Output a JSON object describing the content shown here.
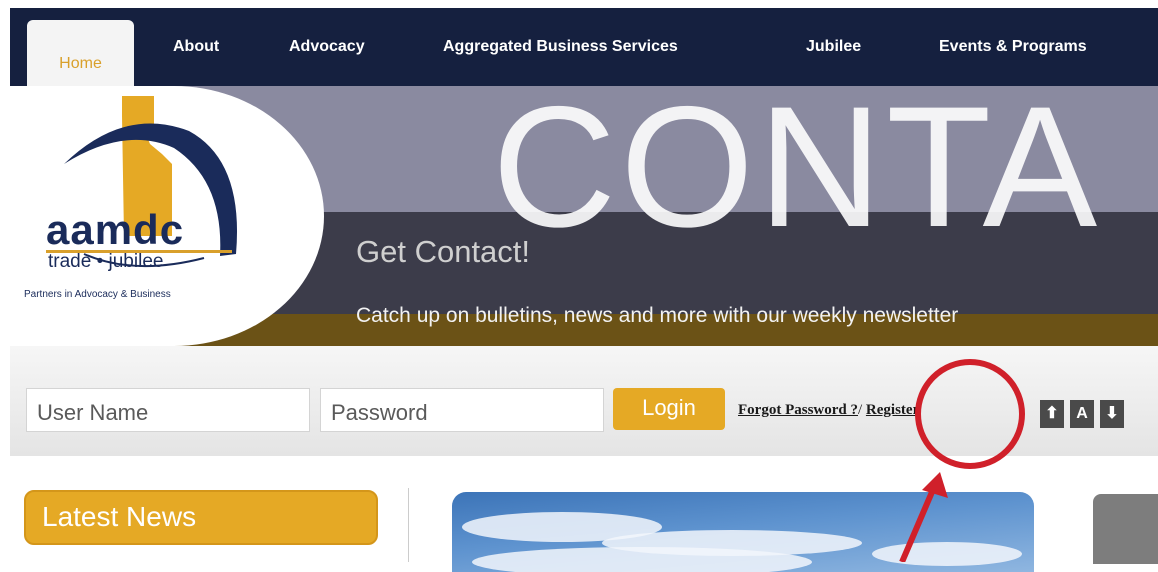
{
  "nav": {
    "items": [
      "Home",
      "About",
      "Advocacy",
      "Aggregated Business Services",
      "Jubilee",
      "Events & Programs"
    ],
    "active": "Home"
  },
  "hero": {
    "big_text": "CONTA",
    "title": "Get Contact!",
    "subtitle": "Catch up on bulletins, news and more with our weekly newsletter"
  },
  "logo": {
    "name": "aamdc",
    "subname": "trade • jubilee",
    "tagline": "Partners in Advocacy & Business"
  },
  "login": {
    "username_placeholder": "User Name",
    "password_placeholder": "Password",
    "login_label": "Login",
    "forgot_label": "Forgot Password ?",
    "separator": "/",
    "register_label": "Register"
  },
  "text_controls": {
    "increase": "⬆",
    "reset": "A",
    "decrease": "⬇"
  },
  "news": {
    "title": "Latest News"
  },
  "colors": {
    "nav_bg": "#15203f",
    "accent_gold": "#e5a925",
    "annotation_red": "#d0202a"
  }
}
